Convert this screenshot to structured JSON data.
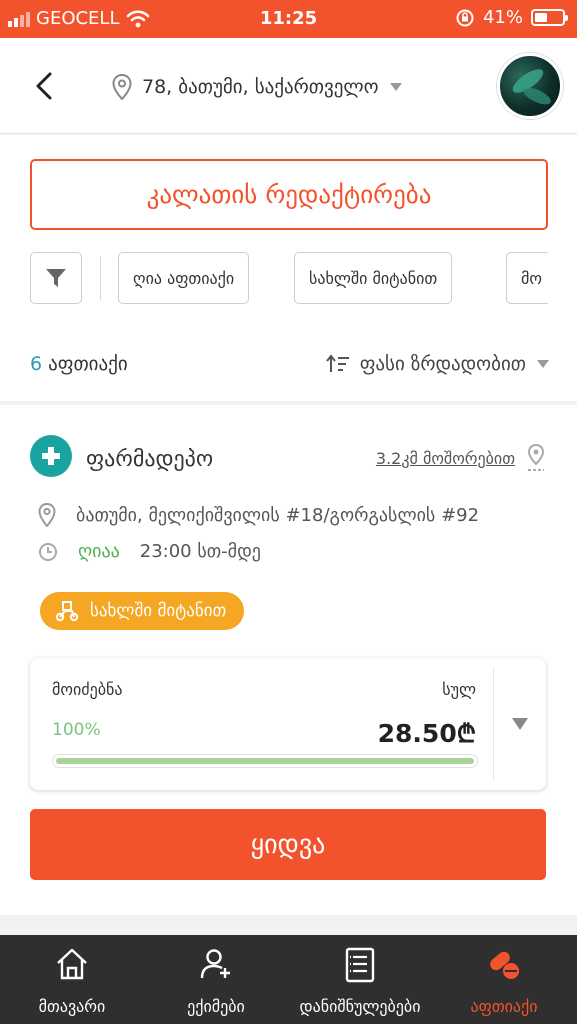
{
  "status_bar": {
    "carrier": "GEOCELL",
    "time": "11:25",
    "battery": "41%"
  },
  "header": {
    "location": "78, ბათუმი, საქართველო"
  },
  "actions": {
    "edit_cart": "კალათის რედაქტირება"
  },
  "filters": {
    "chips": [
      "ღია აფთიაქი",
      "სახლში მიტანით",
      "მო"
    ]
  },
  "results": {
    "count": "6",
    "count_label": "აფთიაქი",
    "sort_label": "ფასი ზრდადობით"
  },
  "pharmacy": {
    "name": "ფარმადეპო",
    "distance_value": "3.2",
    "distance_unit": "კმ მოშორებით",
    "address": "ბათუმი, მელიქიშვილის #18/გორგასლის #92",
    "open_label": "ღიაა",
    "hours": "23:00 სთ-მდე",
    "delivery_badge": "სახლში მიტანით"
  },
  "price_card": {
    "found_label": "მოიძებნა",
    "found_percent": "100%",
    "found_fraction": 1.0,
    "total_label": "სულ",
    "total_value": "28.50₾"
  },
  "buy_button": "ყიდვა",
  "tabbar": {
    "tabs": [
      {
        "label": "მთავარი",
        "icon": "home-icon"
      },
      {
        "label": "ექიმები",
        "icon": "doctor-icon"
      },
      {
        "label": "დანიშნულებები",
        "icon": "prescriptions-icon"
      },
      {
        "label": "აფთიაქი",
        "icon": "pharmacy-icon"
      }
    ],
    "active_index": 3
  },
  "colors": {
    "accent": "#f3532c",
    "teal": "#2a9bb0",
    "open_green": "#4caf50",
    "badge_orange": "#f5a623",
    "tabbar_bg": "#2f2f2f"
  }
}
